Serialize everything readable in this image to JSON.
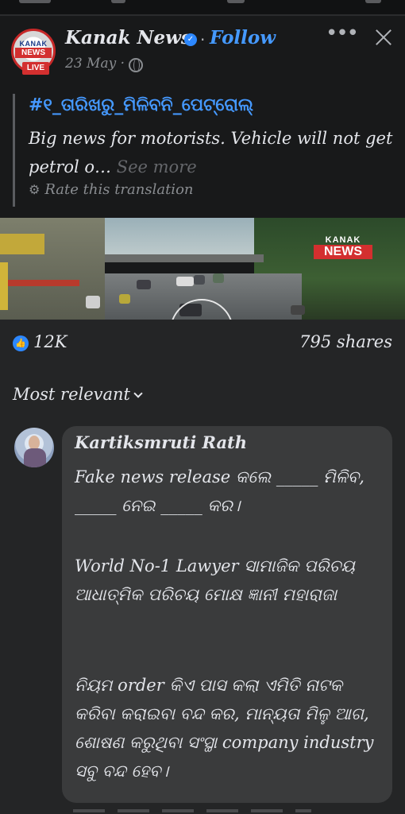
{
  "post": {
    "page_name": "Kanak News",
    "follow_label": "Follow",
    "date": "23 May ·",
    "logo_text_top": "KANAK",
    "logo_text_mid": "NEWS",
    "live_badge": "LIVE",
    "hashtag": "#୧_ତାରିଖରୁ_ମିଳିବନି_ପେଟ୍ରୋଲ୍",
    "text": "Big news for motorists. Vehicle will not get petrol o…",
    "see_more": "See more",
    "rate_translation": "Rate this translation",
    "video_logo_top": "KANAK",
    "video_logo_bottom": "NEWS"
  },
  "reactions": {
    "count": "12K",
    "shares": "795 shares"
  },
  "comments": {
    "sort_label": "Most relevant",
    "items": [
      {
        "author": "Kartiksmruti Rath",
        "para1": "Fake news release କଲେ _____ ମିଳିବ, _____ ନେଇ _____ କର।",
        "para2": "World No-1 Lawyer ସାମାଜିକ ପରିଚୟ ଆଧାତ୍ମିକ ପରିଚୟ ମୋକ୍ଷ ଜ୍ଞାନୀ ମହାରାଜା",
        "para3": "ନିୟମ order କିଏ ପାସ କଲା ଏମିତି ନାଟକ କରିବା କରାଇବା ବନ୍ଦ କର, ମାନ୍ୟତା ମିଳୁ ଆଗ, ଶୋଷଣ କରୁଥିବା ସଂସ୍ଥା company industry ସବୁ ବନ୍ଦ ହେବ।"
      }
    ]
  },
  "icons": {
    "verified": "verified-check-icon",
    "globe": "globe-icon",
    "more": "more-options-icon",
    "close": "close-icon",
    "gear": "gear-icon",
    "like": "like-thumb-icon",
    "chevron": "chevron-down-icon"
  },
  "colors": {
    "accent": "#4599ff",
    "brand_red": "#d32f2f",
    "background": "#242526",
    "bubble": "#3a3b3c"
  }
}
